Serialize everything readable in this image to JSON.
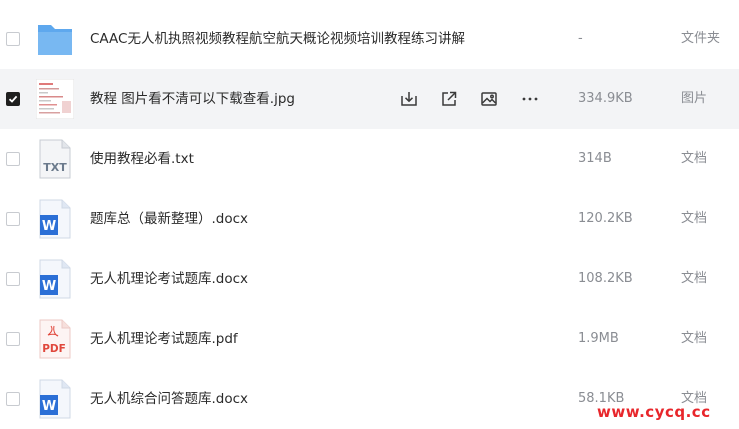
{
  "files": [
    {
      "name": "CAAC无人机执照视频教程航空航天概论视频培训教程练习讲解",
      "size": "-",
      "type": "文件夹",
      "icon": "folder-icon",
      "checked": false
    },
    {
      "name": "教程 图片看不清可以下载查看.jpg",
      "size": "334.9KB",
      "type": "图片",
      "icon": "image-thumbnail",
      "checked": true
    },
    {
      "name": "使用教程必看.txt",
      "size": "314B",
      "type": "文档",
      "icon": "txt-file-icon",
      "checked": false
    },
    {
      "name": "题库总（最新整理）.docx",
      "size": "120.2KB",
      "type": "文档",
      "icon": "word-file-icon",
      "checked": false
    },
    {
      "name": "无人机理论考试题库.docx",
      "size": "108.2KB",
      "type": "文档",
      "icon": "word-file-icon",
      "checked": false
    },
    {
      "name": "无人机理论考试题库.pdf",
      "size": "1.9MB",
      "type": "文档",
      "icon": "pdf-file-icon",
      "checked": false
    },
    {
      "name": "无人机综合问答题库.docx",
      "size": "58.1KB",
      "type": "文档",
      "icon": "word-file-icon",
      "checked": false
    }
  ],
  "icons": {
    "txt_label": "TXT",
    "word_label": "W",
    "pdf_label": "PDF"
  },
  "row_actions": [
    "download-icon",
    "share-icon",
    "preview-image-icon",
    "more-icon"
  ],
  "watermark": "www.cycq.cc",
  "colors": {
    "selected_row_bg": "#f3f4f6",
    "folder": "#5ea8ee",
    "word": "#2b6fd6",
    "pdf": "#e0473c",
    "txt": "#6b7a8c",
    "watermark": "#e8262b"
  }
}
